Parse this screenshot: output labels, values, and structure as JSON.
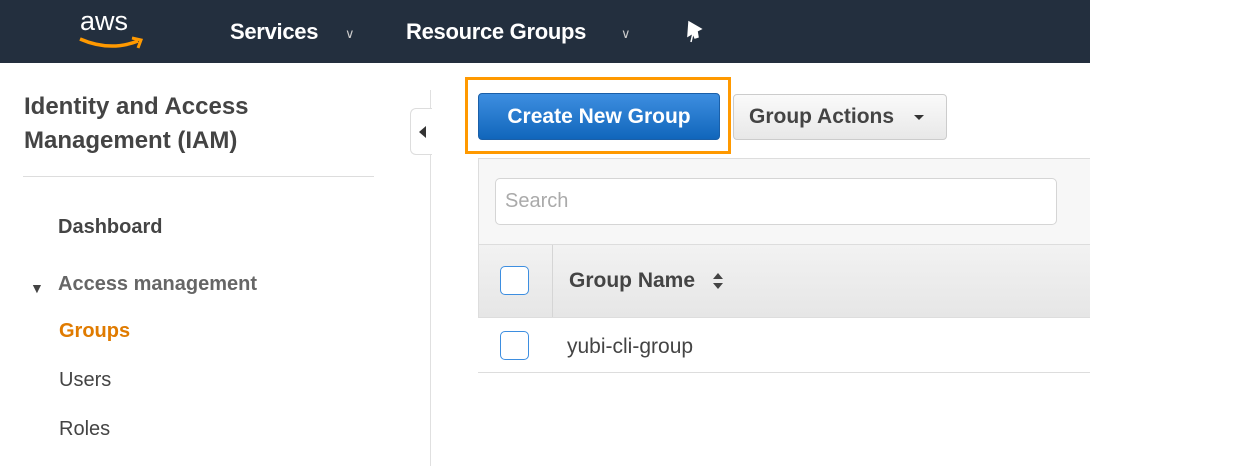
{
  "topbar": {
    "logo": "aws",
    "services": "Services",
    "resource_groups": "Resource Groups"
  },
  "sidebar": {
    "title_line1": "Identity and Access",
    "title_line2": "Management (IAM)",
    "dashboard": "Dashboard",
    "section": "Access management",
    "items": [
      {
        "label": "Groups",
        "active": true
      },
      {
        "label": "Users"
      },
      {
        "label": "Roles"
      }
    ]
  },
  "toolbar": {
    "create_label": "Create New Group",
    "actions_label": "Group Actions"
  },
  "search": {
    "placeholder": "Search",
    "value": ""
  },
  "table": {
    "columns": [
      "Group Name"
    ],
    "rows": [
      {
        "group_name": "yubi-cli-group"
      }
    ]
  },
  "colors": {
    "topbar": "#232f3e",
    "accent": "#ff9900",
    "active_nav": "#e07b00",
    "primary": "#1a73c8"
  }
}
